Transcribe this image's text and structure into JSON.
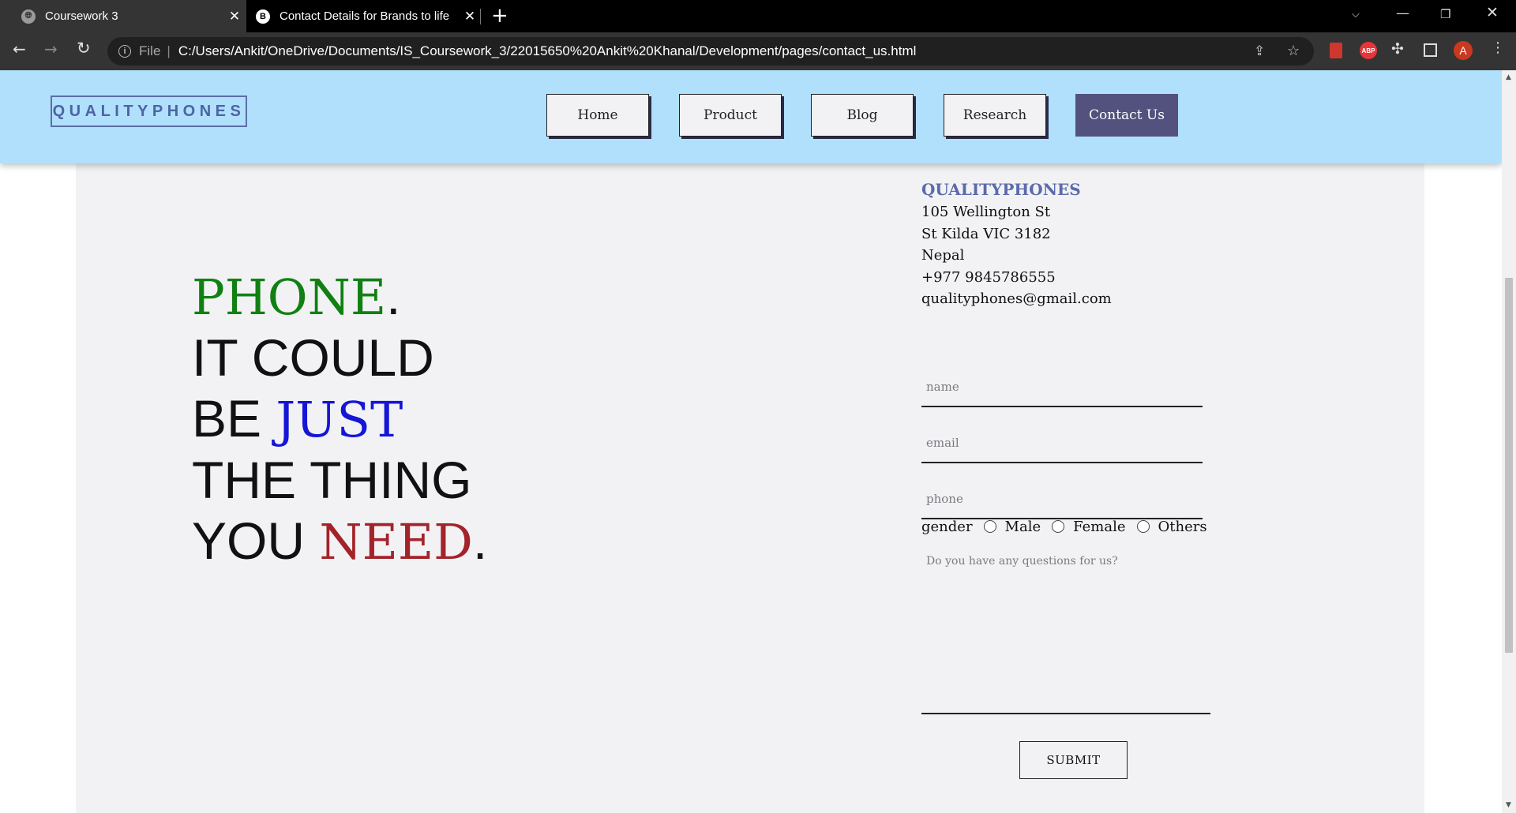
{
  "browser": {
    "tabs": [
      {
        "title": "Coursework 3",
        "favicon": "globe-icon",
        "active": true
      },
      {
        "title": "Contact Details for Brands to life",
        "favicon": "B",
        "active": false
      }
    ],
    "address": {
      "scheme": "File",
      "url": "C:/Users/Ankit/OneDrive/Documents/IS_Coursework_3/22015650%20Ankit%20Khanal/Development/pages/contact_us.html"
    },
    "profile_initial": "A",
    "abp_label": "ABP"
  },
  "site": {
    "logo": "QUALITYPHONES",
    "nav": [
      {
        "label": "Home",
        "active": false
      },
      {
        "label": "Product",
        "active": false
      },
      {
        "label": "Blog",
        "active": false
      },
      {
        "label": "Research",
        "active": false
      },
      {
        "label": "Contact Us",
        "active": true
      }
    ]
  },
  "hero": {
    "word_phone": "PHONE",
    "dot": ".",
    "it_could": "IT COULD",
    "be": "BE",
    "just": "JUST",
    "the_thing": "THE THING",
    "you": "YOU",
    "need": "NEED",
    "end_dot": "."
  },
  "contact": {
    "company": "QUALITYPHONES",
    "street": "105 Wellington St",
    "city": "St Kilda VIC 3182",
    "country": "Nepal",
    "phone": "+977 9845786555",
    "email": "qualityphones@gmail.com"
  },
  "form": {
    "name_placeholder": "name",
    "email_placeholder": "email",
    "phone_placeholder": "phone",
    "gender_label": "gender",
    "gender_options": [
      "Male",
      "Female",
      "Others"
    ],
    "question_placeholder": "Do you have any questions for us?",
    "submit_label": "SUBMIT"
  },
  "colors": {
    "header_bg": "#b0e0fc",
    "active_nav": "#53527f",
    "phone_green": "#118013",
    "just_blue": "#1515d8",
    "need_red": "#a3232a"
  }
}
